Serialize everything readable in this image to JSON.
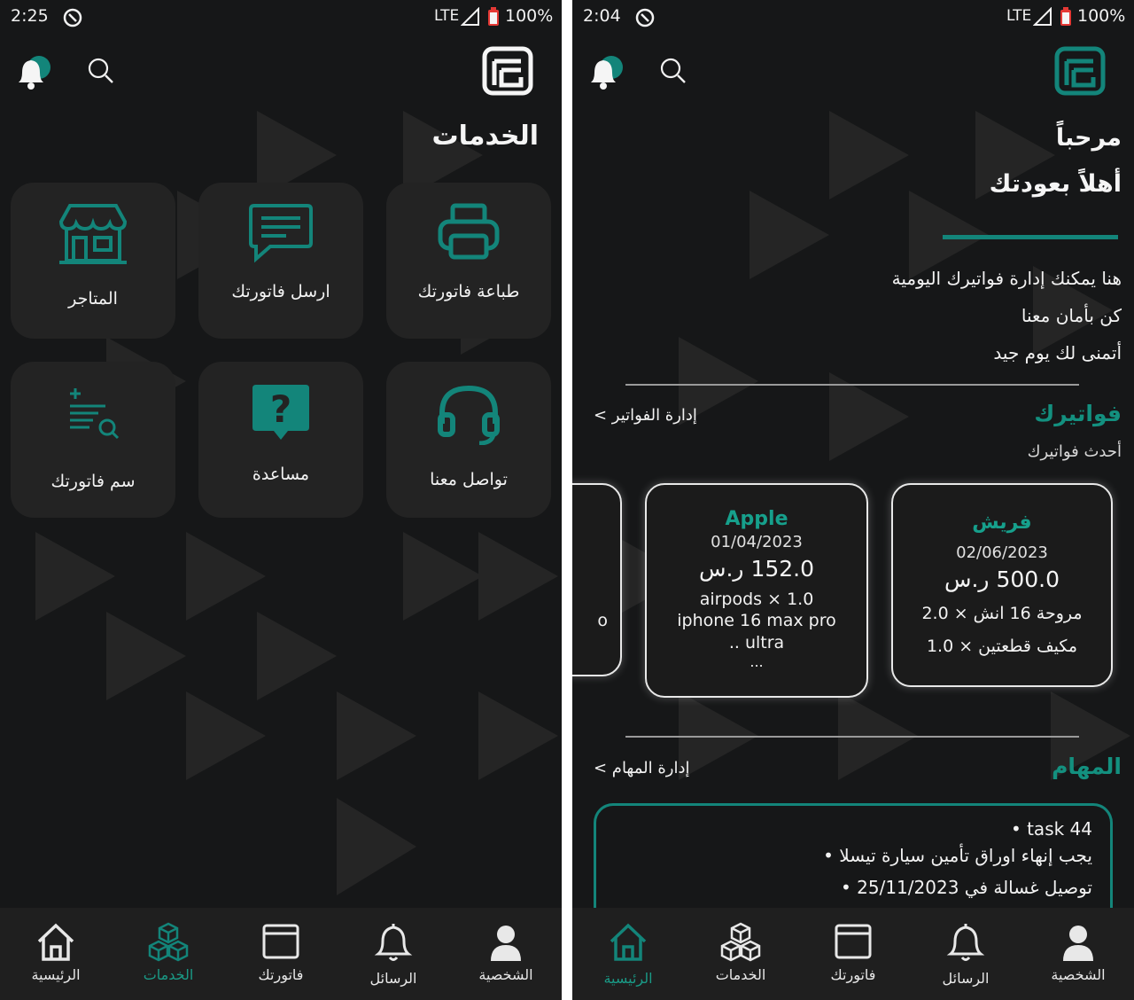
{
  "colors": {
    "accent": "#13857a",
    "background": "#161718",
    "tile": "#232323"
  },
  "left": {
    "status": {
      "time": "2:25",
      "network": "LTE",
      "battery": "100%"
    },
    "page_title": "الخدمات",
    "tiles": [
      {
        "label": "طباعة فاتورتك",
        "icon": "printer-icon"
      },
      {
        "label": "ارسل فاتورتك",
        "icon": "message-icon"
      },
      {
        "label": "المتاجر",
        "icon": "store-icon"
      },
      {
        "label": "تواصل معنا",
        "icon": "headset-icon"
      },
      {
        "label": "مساعدة",
        "icon": "help-icon"
      },
      {
        "label": "سم فاتورتك",
        "icon": "list-search-icon"
      }
    ],
    "nav": {
      "home": "الرئيسية",
      "services": "الخدمات",
      "invoices": "فاتورتك",
      "messages": "الرسائل",
      "profile": "الشخصية",
      "active": "services"
    }
  },
  "right": {
    "status": {
      "time": "2:04",
      "network": "LTE",
      "battery": "100%"
    },
    "greeting": "مرحباً",
    "welcome_back": "أهلاً بعودتك",
    "intro": [
      "هنا يمكنك إدارة فواتيرك اليومية",
      "كن بأمان معنا",
      "أتمنى لك يوم جيد"
    ],
    "invoices_section": {
      "title": "فواتيرك",
      "link": "إدارة الفواتير >",
      "subtitle": "أحدث فواتيرك"
    },
    "invoice_cards": [
      {
        "store": "فريش",
        "date": "02/06/2023",
        "amount": "500.0 ر.س",
        "items": [
          "مروحة 16 انش × 2.0",
          "مكيف قطعتين × 1.0"
        ]
      },
      {
        "store": "Apple",
        "date": "01/04/2023",
        "amount": "152.0 ر.س",
        "items": [
          "airpods × 1.0",
          "iphone 16 max pro",
          "ultra ..",
          "..."
        ]
      },
      {
        "partial_text": "o"
      }
    ],
    "tasks_section": {
      "title": "المهام",
      "link": "إدارة المهام >",
      "tasks": [
        "task 44 •",
        "يجب إنهاء اوراق تأمين سيارة تيسلا •",
        "توصيل غسالة في 25/11/2023 •"
      ]
    },
    "nav": {
      "home": "الرئيسية",
      "services": "الخدمات",
      "invoices": "فاتورتك",
      "messages": "الرسائل",
      "profile": "الشخصية",
      "active": "home"
    }
  }
}
